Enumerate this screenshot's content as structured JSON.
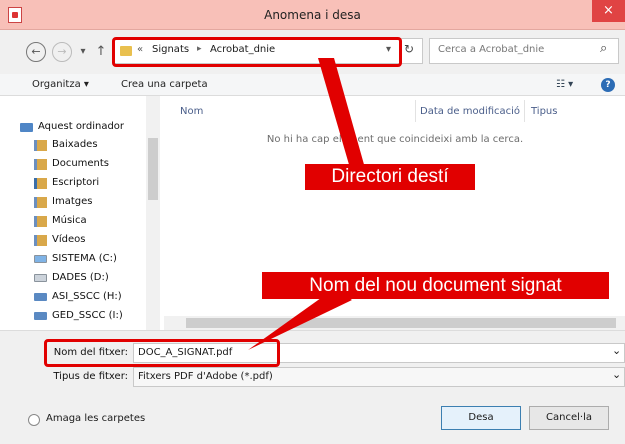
{
  "window": {
    "title": "Anomena i desa",
    "close_glyph": "×"
  },
  "nav": {
    "back_glyph": "←",
    "forward_glyph": "→",
    "dropdown_glyph": "▾",
    "up_glyph": "↑",
    "breadcrumb_overflow": "«",
    "breadcrumb": [
      "Signats",
      "Acrobat_dnie"
    ],
    "breadcrumb_sep": "▸",
    "refresh_glyph": "↻",
    "search_placeholder": "Cerca a Acrobat_dnie",
    "search_glyph": "⌕"
  },
  "toolbar": {
    "organize": "Organitza ▾",
    "new_folder": "Crea una carpeta",
    "view_glyph": "☷ ▾",
    "help_glyph": "?"
  },
  "sidebar": {
    "computer": "Aquest ordinador",
    "items": [
      {
        "label": "Baixades",
        "icon": "downloads-icon"
      },
      {
        "label": "Documents",
        "icon": "documents-icon"
      },
      {
        "label": "Escriptori",
        "icon": "desktop-icon"
      },
      {
        "label": "Imatges",
        "icon": "pictures-icon"
      },
      {
        "label": "Música",
        "icon": "music-icon"
      },
      {
        "label": "Vídeos",
        "icon": "videos-icon"
      },
      {
        "label": "SISTEMA (C:)",
        "icon": "system-drive-icon"
      },
      {
        "label": "DADES (D:)",
        "icon": "drive-icon"
      },
      {
        "label": "ASI_SSCC (H:)",
        "icon": "network-drive-icon"
      },
      {
        "label": "GED_SSCC (I:)",
        "icon": "network-drive-icon"
      }
    ]
  },
  "filelist": {
    "columns": [
      "Nom",
      "Data de modificació",
      "Tipus"
    ],
    "empty_message": "No hi ha cap element que coincideixi amb la cerca."
  },
  "form": {
    "filename_label": "Nom del fitxer:",
    "filename_value": "DOC_A_SIGNAT.pdf",
    "filetype_label": "Tipus de fitxer:",
    "filetype_value": "Fitxers PDF d'Adobe (*.pdf)",
    "hide_folders": "Amaga les carpetes",
    "save": "Desa",
    "cancel": "Cancel·la",
    "chevron": "⌄"
  },
  "annotations": {
    "folder_callout": "Directori destí",
    "filename_callout": "Nom del nou document signat",
    "color": "#e10000"
  }
}
